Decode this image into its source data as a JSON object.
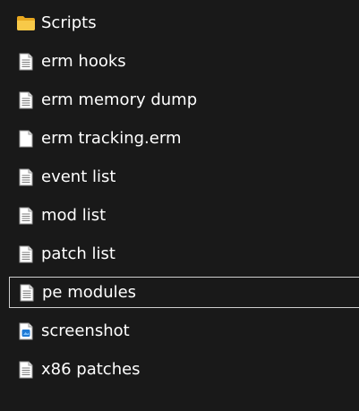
{
  "items": [
    {
      "label": "Scripts",
      "icon": "folder-icon"
    },
    {
      "label": "erm hooks",
      "icon": "text-file-icon"
    },
    {
      "label": "erm memory dump",
      "icon": "text-file-icon"
    },
    {
      "label": "erm tracking.erm",
      "icon": "blank-file-icon"
    },
    {
      "label": "event list",
      "icon": "text-file-icon"
    },
    {
      "label": "mod list",
      "icon": "text-file-icon"
    },
    {
      "label": "patch list",
      "icon": "text-file-icon"
    },
    {
      "label": "pe modules",
      "icon": "text-file-icon",
      "selected": true
    },
    {
      "label": "screenshot",
      "icon": "image-file-icon"
    },
    {
      "label": "x86 patches",
      "icon": "text-file-icon"
    }
  ],
  "colors": {
    "background": "#191919",
    "text": "#ffffff",
    "folder": "#f4c430",
    "selection_border": "#cfcfcf"
  }
}
